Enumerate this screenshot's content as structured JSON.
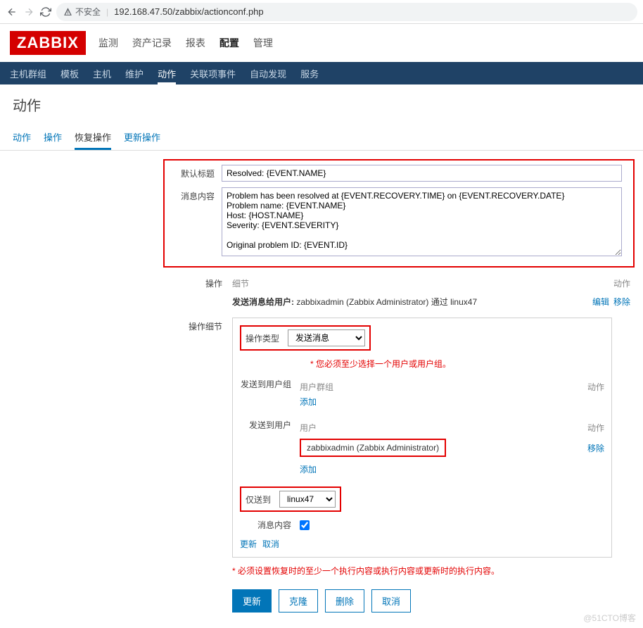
{
  "browser": {
    "insecure": "不安全",
    "url": "192.168.47.50/zabbix/actionconf.php"
  },
  "logo": "ZABBIX",
  "main_nav": [
    "监测",
    "资产记录",
    "报表",
    "配置",
    "管理"
  ],
  "main_nav_active": 3,
  "sub_nav": [
    "主机群组",
    "模板",
    "主机",
    "维护",
    "动作",
    "关联项事件",
    "自动发现",
    "服务"
  ],
  "sub_nav_active": 4,
  "page_title": "动作",
  "tabs": [
    "动作",
    "操作",
    "恢复操作",
    "更新操作"
  ],
  "tab_active": 2,
  "form": {
    "subject_label": "默认标题",
    "subject_value": "Resolved: {EVENT.NAME}",
    "message_label": "消息内容",
    "message_value": "Problem has been resolved at {EVENT.RECOVERY.TIME} on {EVENT.RECOVERY.DATE}\nProblem name: {EVENT.NAME}\nHost: {HOST.NAME}\nSeverity: {EVENT.SEVERITY}\n\nOriginal problem ID: {EVENT.ID}"
  },
  "ops": {
    "label": "操作",
    "head_detail": "细节",
    "head_action": "动作",
    "row_prefix": "发送消息给用户: ",
    "row_user": "zabbixadmin (Zabbix Administrator) 通过 linux47",
    "edit": "编辑",
    "remove": "移除"
  },
  "op_detail": {
    "label": "操作细节",
    "type_label": "操作类型",
    "type_value": "发送消息",
    "required": "* 您必须至少选择一个用户或用户组。",
    "send_group_label": "发送到用户组",
    "col_usergroup": "用户群组",
    "col_action": "动作",
    "add": "添加",
    "send_user_label": "发送到用户",
    "col_user": "用户",
    "user_value": "zabbixadmin (Zabbix Administrator)",
    "remove": "移除",
    "only_label": "仅送到",
    "only_value": "linux47",
    "msg_label": "消息内容",
    "update": "更新",
    "cancel": "取消"
  },
  "required_outer": "* 必须设置恢复时的至少一个执行内容或执行内容或更新时的执行内容。",
  "buttons": {
    "update": "更新",
    "clone": "克隆",
    "delete": "删除",
    "cancel": "取消"
  },
  "watermark": "@51CTO博客"
}
